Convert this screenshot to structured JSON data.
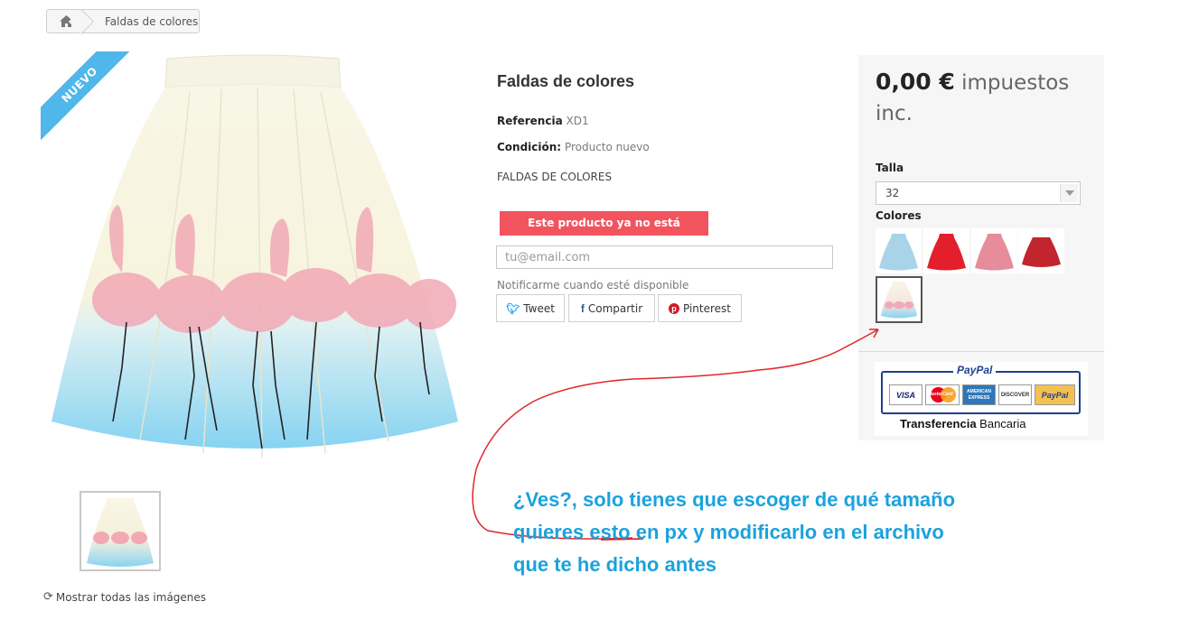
{
  "breadcrumb": {
    "home_icon": "home-icon",
    "current": "Faldas de colores"
  },
  "product": {
    "badge": "NUEVO",
    "title": "Faldas de colores",
    "reference_label": "Referencia",
    "reference_value": "XD1",
    "condition_label": "Condición:",
    "condition_value": "Producto nuevo",
    "short_description": "FALDAS DE COLORES",
    "unavailable_message": "Este producto ya no está disponible",
    "email_placeholder": "tu@email.com",
    "notify_text": "Notificarme cuando esté disponible",
    "show_all_images": "Mostrar todas las imágenes"
  },
  "social": {
    "tweet": "Tweet",
    "share": "Compartir",
    "pinterest": "Pinterest",
    "twitter_color": "#1da1f2",
    "facebook_color": "#3b5998",
    "pinterest_color": "#cb2027"
  },
  "buy_panel": {
    "price_amount": "0,00 €",
    "price_suffix": "impuestos inc.",
    "size_label": "Talla",
    "size_selected": "32",
    "colors_label": "Colores",
    "swatches": [
      {
        "name": "light-blue-skirt",
        "color": "#a9d3e8"
      },
      {
        "name": "red-skirt",
        "color": "#e21f2a"
      },
      {
        "name": "pink-skirt",
        "color": "#e68c9a"
      },
      {
        "name": "dark-red-skirt",
        "color": "#c1262f"
      },
      {
        "name": "flamingo-skirt",
        "color": "#f4c4cc"
      }
    ]
  },
  "payment": {
    "paypal_title": "PayPal",
    "cards": [
      "VISA",
      "MasterCard",
      "AMERICAN EXPRESS",
      "DISCOVER",
      "PayPal"
    ],
    "transfer_bold": "Transferencia",
    "transfer_regular": "Bancaria"
  },
  "annotation": {
    "line1": "¿Ves?, solo tienes que escoger de qué tamaño",
    "line2_before": "quieres ",
    "line2_underlined": "esto",
    "line2_after": " en px y modificarlo en el archivo",
    "line3": "que te he dicho antes",
    "color": "#1ba2dd",
    "arrow_color": "#e0262b"
  },
  "accent_color": "#4fb7ea",
  "alert_color": "#f2545f"
}
